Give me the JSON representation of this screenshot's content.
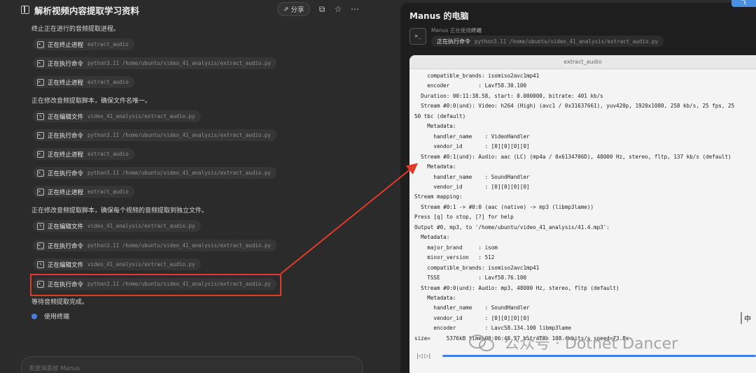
{
  "header": {
    "title": "解析视频内容提取学习资料",
    "share_label": "分享"
  },
  "chat": {
    "texts": [
      "终止正在进行的音频提取进程。",
      "正在修改音频提取脚本，确保文件名唯一。",
      "正在修改音频提取脚本，确保每个视频的音频提取到独立文件。",
      "等待音频提取完成。"
    ],
    "steps": [
      {
        "action": "正在终止进程",
        "arg": "extract_audio"
      },
      {
        "action": "正在执行命令",
        "arg": "python3.11 /home/ubuntu/video_41_analysis/extract_audio.py"
      },
      {
        "action": "正在终止进程",
        "arg": "extract_audio"
      },
      {
        "action": "正在编辑文件",
        "arg": "video_41_analysis/extract_audio.py"
      },
      {
        "action": "正在执行命令",
        "arg": "python3.11 /home/ubuntu/video_41_analysis/extract_audio.py"
      },
      {
        "action": "正在终止进程",
        "arg": "extract_audio"
      },
      {
        "action": "正在执行命令",
        "arg": "python3.11 /home/ubuntu/video_41_analysis/extract_audio.py"
      },
      {
        "action": "正在终止进程",
        "arg": "extract_audio"
      },
      {
        "action": "正在编辑文件",
        "arg": "video_41_analysis/extract_audio.py"
      },
      {
        "action": "正在执行命令",
        "arg": "python3.11 /home/ubuntu/video_41_analysis/extract_audio.py"
      },
      {
        "action": "正在编辑文件",
        "arg": "video_41_analysis/extract_audio.py"
      },
      {
        "action": "正在执行命令",
        "arg": "python3.11 /home/ubuntu/video_41_analysis/extract_audio.py"
      }
    ],
    "terminal_label": "使用终端",
    "message_placeholder": "发送消息给 Manus"
  },
  "computer": {
    "title": "Manus 的电脑",
    "using_prefix": "Manus 正在使用",
    "using_tool": "终端",
    "current_action": "正在执行命令",
    "current_arg": "python3.11 /home/ubuntu/video_41_analysis/extract_audio.py",
    "terminal_title": "extract_audio",
    "terminal_lines": [
      "    compatible_brands: isomiso2avc1mp41",
      "    encoder         : Lavf58.30.100",
      "  Duration: 00:11:38.58, start: 0.000000, bitrate: 401 kb/s",
      "  Stream #0:0(und): Video: h264 (High) (avc1 / 0x31637661), yuv420p, 1920x1080, 258 kb/s, 25 fps, 25",
      "50 tbc (default)",
      "    Metadata:",
      "      handler_name    : VideoHandler",
      "      vendor_id       : [0][0][0][0]",
      "  Stream #0:1(und): Audio: aac (LC) (mp4a / 0x6134706D), 48000 Hz, stereo, fltp, 137 kb/s (default)",
      "    Metadata:",
      "      handler_name    : SoundHandler",
      "      vendor_id       : [0][0][0][0]",
      "Stream mapping:",
      "  Stream #0:1 -> #0:0 (aac (native) -> mp3 (libmp3lame))",
      "Press [q] to stop, [?] for help",
      "Output #0, mp3, to '/home/ubuntu/video_41_analysis/41.4.mp3':",
      "  Metadata:",
      "    major_brand     : isom",
      "    minor_version   : 512",
      "    compatible_brands: isomiso2avc1mp41",
      "    TSSE            : Lavf58.76.100",
      "  Stream #0:0(und): Audio: mp3, 48000 Hz, stereo, fltp (default)",
      "    Metadata:",
      "      handler_name    : SoundHandler",
      "      vendor_id       : [0][0][0][0]",
      "      encoder         : Lavc58.134.100 libmp3lame",
      "size=     5376kB time=00:06:46.37 bitrate= 108.4kbits/s speed=73.8x"
    ],
    "ime_label": "中"
  },
  "watermark": "公众号 · Dotnet Dancer",
  "badge": "飞"
}
